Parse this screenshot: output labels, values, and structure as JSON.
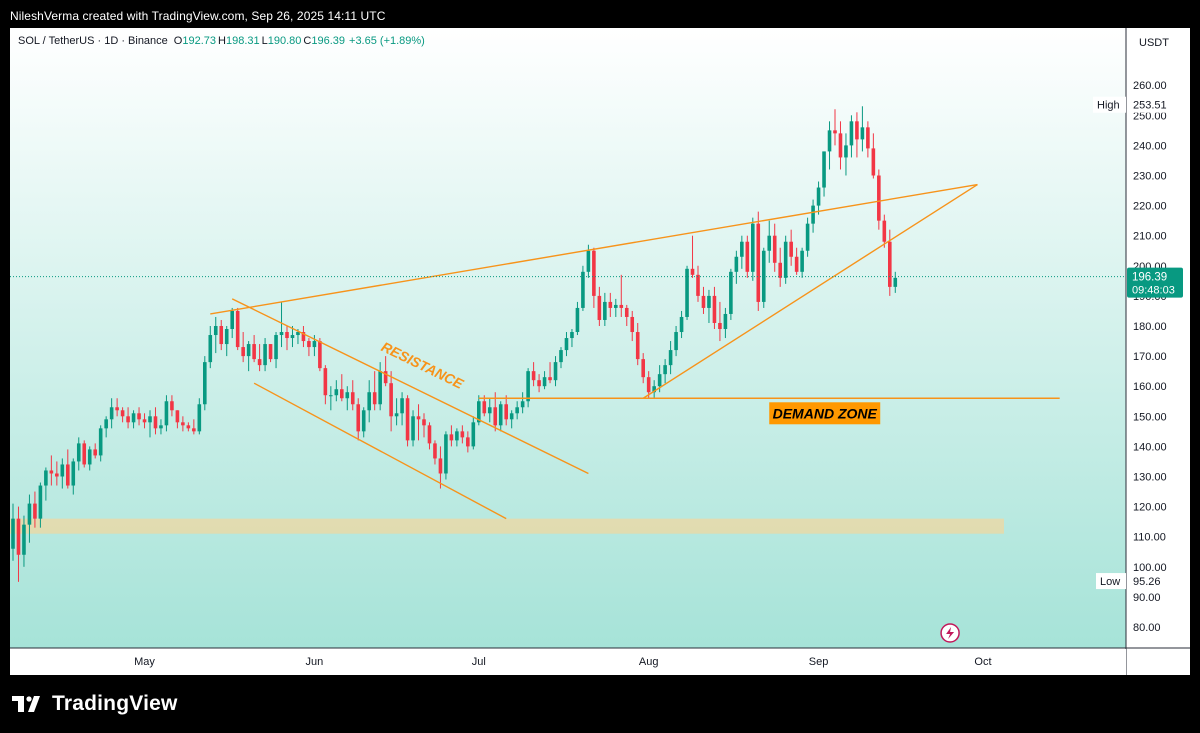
{
  "header": {
    "credit": "NileshVerma created with TradingView.com, Sep 26, 2025 14:11 UTC"
  },
  "legend": {
    "symbol": "SOL / TetherUS · 1D · Binance",
    "o_label": "O",
    "o_value": "192.73",
    "h_label": "H",
    "h_value": "198.31",
    "l_label": "L",
    "l_value": "190.80",
    "c_label": "C",
    "c_value": "196.39",
    "change": "+3.65 (+1.89%)"
  },
  "price_axis": {
    "unit": "USDT",
    "ticks": [
      "80.00",
      "90.00",
      "100.00",
      "110.00",
      "120.00",
      "130.00",
      "140.00",
      "150.00",
      "160.00",
      "170.00",
      "180.00",
      "190.00",
      "200.00",
      "210.00",
      "220.00",
      "230.00",
      "240.00",
      "250.00",
      "260.00"
    ],
    "high_label": "High",
    "high_value": "253.51",
    "low_label": "Low",
    "low_value": "95.26",
    "last_price": "196.39",
    "countdown": "09:48:03"
  },
  "time_axis": {
    "labels": [
      "May",
      "Jun",
      "Jul",
      "Aug",
      "Sep",
      "Oct"
    ]
  },
  "annotations": {
    "resistance": "RESISTANCE",
    "demand_zone": "DEMAND ZONE"
  },
  "brand": {
    "name": "TradingView"
  },
  "colors": {
    "up": "#089981",
    "down": "#f23645",
    "trendline": "#f7931a",
    "zone": "#e9d9a8",
    "bg_top": "#ffffff",
    "bg_bottom": "#a6e3d8",
    "demand_label_bg": "#ff9800"
  },
  "chart_data": {
    "type": "candlestick",
    "symbol": "SOL / TetherUS",
    "interval": "1D",
    "exchange": "Binance",
    "x_start": "2025-04-07",
    "ylim": [
      75,
      268
    ],
    "y_ticks": [
      80,
      90,
      100,
      110,
      120,
      130,
      140,
      150,
      160,
      170,
      180,
      190,
      200,
      210,
      220,
      230,
      240,
      250,
      260
    ],
    "x_ticks": [
      {
        "label": "May",
        "date": "2025-05-01"
      },
      {
        "label": "Jun",
        "date": "2025-06-01"
      },
      {
        "label": "Jul",
        "date": "2025-07-01"
      },
      {
        "label": "Aug",
        "date": "2025-08-01"
      },
      {
        "label": "Sep",
        "date": "2025-09-01"
      },
      {
        "label": "Oct",
        "date": "2025-10-01"
      }
    ],
    "ohlc": [
      [
        106,
        121,
        102,
        116
      ],
      [
        116,
        120,
        95,
        104
      ],
      [
        104,
        117,
        100,
        114
      ],
      [
        114,
        124,
        108,
        121
      ],
      [
        121,
        125,
        113,
        116
      ],
      [
        116,
        128,
        113,
        127
      ],
      [
        127,
        133,
        122,
        132
      ],
      [
        132,
        137,
        127,
        131
      ],
      [
        131,
        135,
        127,
        130
      ],
      [
        130,
        136,
        126,
        134
      ],
      [
        134,
        139,
        126,
        127
      ],
      [
        127,
        136,
        124,
        135
      ],
      [
        135,
        143,
        132,
        141
      ],
      [
        141,
        142,
        133,
        134
      ],
      [
        134,
        140,
        132,
        139
      ],
      [
        139,
        141,
        136,
        137
      ],
      [
        137,
        147,
        135,
        146
      ],
      [
        146,
        150,
        143,
        149
      ],
      [
        149,
        156,
        146,
        153
      ],
      [
        153,
        156,
        150,
        152
      ],
      [
        152,
        153,
        148,
        150
      ],
      [
        150,
        153,
        146,
        148
      ],
      [
        148,
        152,
        146,
        151
      ],
      [
        151,
        153,
        147,
        149
      ],
      [
        149,
        151,
        146,
        148
      ],
      [
        148,
        152,
        143,
        150
      ],
      [
        150,
        153,
        144,
        146
      ],
      [
        146,
        149,
        144,
        147
      ],
      [
        147,
        157,
        145,
        155
      ],
      [
        155,
        157,
        150,
        152
      ],
      [
        152,
        152,
        146,
        148
      ],
      [
        148,
        150,
        145,
        147
      ],
      [
        147,
        148,
        145,
        146
      ],
      [
        146,
        149,
        144,
        145
      ],
      [
        145,
        156,
        144,
        154
      ],
      [
        154,
        170,
        152,
        168
      ],
      [
        168,
        180,
        166,
        177
      ],
      [
        177,
        183,
        171,
        180
      ],
      [
        180,
        182,
        172,
        174
      ],
      [
        174,
        180,
        170,
        179
      ],
      [
        179,
        186,
        176,
        185
      ],
      [
        185,
        186,
        172,
        173
      ],
      [
        173,
        178,
        168,
        170
      ],
      [
        170,
        175,
        165,
        174
      ],
      [
        174,
        177,
        168,
        169
      ],
      [
        169,
        174,
        165,
        167
      ],
      [
        167,
        176,
        165,
        174
      ],
      [
        174,
        174,
        168,
        169
      ],
      [
        169,
        178,
        166,
        177
      ],
      [
        177,
        188,
        173,
        178
      ],
      [
        178,
        180,
        172,
        176
      ],
      [
        176,
        180,
        173,
        177
      ],
      [
        177,
        179,
        174,
        178
      ],
      [
        178,
        180,
        173,
        175
      ],
      [
        175,
        176,
        170,
        173
      ],
      [
        173,
        177,
        170,
        175
      ],
      [
        175,
        176,
        165,
        166
      ],
      [
        166,
        167,
        154,
        157
      ],
      [
        157,
        160,
        152,
        157
      ],
      [
        157,
        162,
        155,
        159
      ],
      [
        159,
        164,
        155,
        156
      ],
      [
        156,
        160,
        152,
        158
      ],
      [
        158,
        162,
        152,
        154
      ],
      [
        154,
        156,
        142,
        145
      ],
      [
        145,
        153,
        143,
        152
      ],
      [
        152,
        162,
        148,
        158
      ],
      [
        158,
        165,
        152,
        154
      ],
      [
        154,
        168,
        152,
        165
      ],
      [
        165,
        170,
        160,
        161
      ],
      [
        161,
        165,
        145,
        150
      ],
      [
        150,
        156,
        147,
        151
      ],
      [
        151,
        158,
        147,
        156
      ],
      [
        156,
        157,
        140,
        142
      ],
      [
        142,
        152,
        140,
        150
      ],
      [
        150,
        154,
        142,
        149
      ],
      [
        149,
        151,
        143,
        147
      ],
      [
        147,
        148,
        139,
        141
      ],
      [
        141,
        142,
        134,
        136
      ],
      [
        136,
        140,
        126,
        131
      ],
      [
        131,
        145,
        129,
        144
      ],
      [
        144,
        147,
        140,
        142
      ],
      [
        142,
        146,
        140,
        145
      ],
      [
        145,
        147,
        141,
        143
      ],
      [
        143,
        145,
        138,
        140
      ],
      [
        140,
        150,
        139,
        148
      ],
      [
        148,
        157,
        147,
        155
      ],
      [
        155,
        157,
        150,
        151
      ],
      [
        151,
        156,
        148,
        153
      ],
      [
        153,
        158,
        145,
        147
      ],
      [
        147,
        155,
        145,
        154
      ],
      [
        154,
        157,
        147,
        149
      ],
      [
        149,
        152,
        146,
        151
      ],
      [
        151,
        155,
        149,
        153
      ],
      [
        153,
        158,
        151,
        155
      ],
      [
        155,
        166,
        153,
        165
      ],
      [
        165,
        168,
        160,
        162
      ],
      [
        162,
        164,
        158,
        160
      ],
      [
        160,
        165,
        159,
        163
      ],
      [
        163,
        168,
        161,
        162
      ],
      [
        162,
        170,
        160,
        168
      ],
      [
        168,
        173,
        166,
        172
      ],
      [
        172,
        178,
        170,
        176
      ],
      [
        176,
        179,
        173,
        178
      ],
      [
        178,
        188,
        177,
        186
      ],
      [
        186,
        200,
        185,
        198
      ],
      [
        198,
        207,
        196,
        205
      ],
      [
        205,
        206,
        186,
        190
      ],
      [
        190,
        193,
        180,
        182
      ],
      [
        182,
        191,
        180,
        188
      ],
      [
        188,
        191,
        183,
        186
      ],
      [
        186,
        189,
        183,
        187
      ],
      [
        187,
        197,
        183,
        186
      ],
      [
        186,
        187,
        180,
        183
      ],
      [
        183,
        185,
        175,
        178
      ],
      [
        178,
        181,
        167,
        169
      ],
      [
        169,
        171,
        161,
        163
      ],
      [
        163,
        165,
        156,
        158
      ],
      [
        158,
        162,
        156,
        160
      ],
      [
        160,
        167,
        158,
        164
      ],
      [
        164,
        169,
        161,
        167
      ],
      [
        167,
        175,
        164,
        172
      ],
      [
        172,
        180,
        170,
        178
      ],
      [
        178,
        185,
        176,
        183
      ],
      [
        183,
        200,
        182,
        199
      ],
      [
        199,
        210,
        196,
        197
      ],
      [
        197,
        200,
        188,
        190
      ],
      [
        190,
        193,
        184,
        186
      ],
      [
        186,
        192,
        181,
        190
      ],
      [
        190,
        193,
        179,
        181
      ],
      [
        181,
        188,
        175,
        179
      ],
      [
        179,
        186,
        176,
        184
      ],
      [
        184,
        199,
        182,
        198
      ],
      [
        198,
        205,
        194,
        203
      ],
      [
        203,
        210,
        199,
        208
      ],
      [
        208,
        210,
        196,
        198
      ],
      [
        198,
        216,
        195,
        214
      ],
      [
        214,
        218,
        185,
        188
      ],
      [
        188,
        206,
        186,
        205
      ],
      [
        205,
        215,
        201,
        210
      ],
      [
        210,
        214,
        198,
        201
      ],
      [
        201,
        206,
        193,
        196
      ],
      [
        196,
        210,
        194,
        208
      ],
      [
        208,
        212,
        200,
        203
      ],
      [
        203,
        206,
        197,
        198
      ],
      [
        198,
        206,
        196,
        205
      ],
      [
        205,
        216,
        203,
        214
      ],
      [
        214,
        222,
        211,
        220
      ],
      [
        220,
        228,
        217,
        226
      ],
      [
        226,
        238,
        223,
        238
      ],
      [
        238,
        248,
        232,
        245
      ],
      [
        245,
        252,
        240,
        244
      ],
      [
        244,
        248,
        232,
        236
      ],
      [
        236,
        244,
        230,
        240
      ],
      [
        240,
        250,
        236,
        248
      ],
      [
        248,
        251,
        236,
        242
      ],
      [
        242,
        253,
        238,
        246
      ],
      [
        246,
        248,
        236,
        239
      ],
      [
        239,
        244,
        229,
        230
      ],
      [
        230,
        232,
        212,
        215
      ],
      [
        215,
        217,
        206,
        208
      ],
      [
        208,
        212,
        190,
        193
      ],
      [
        193,
        198,
        191,
        196
      ]
    ]
  }
}
